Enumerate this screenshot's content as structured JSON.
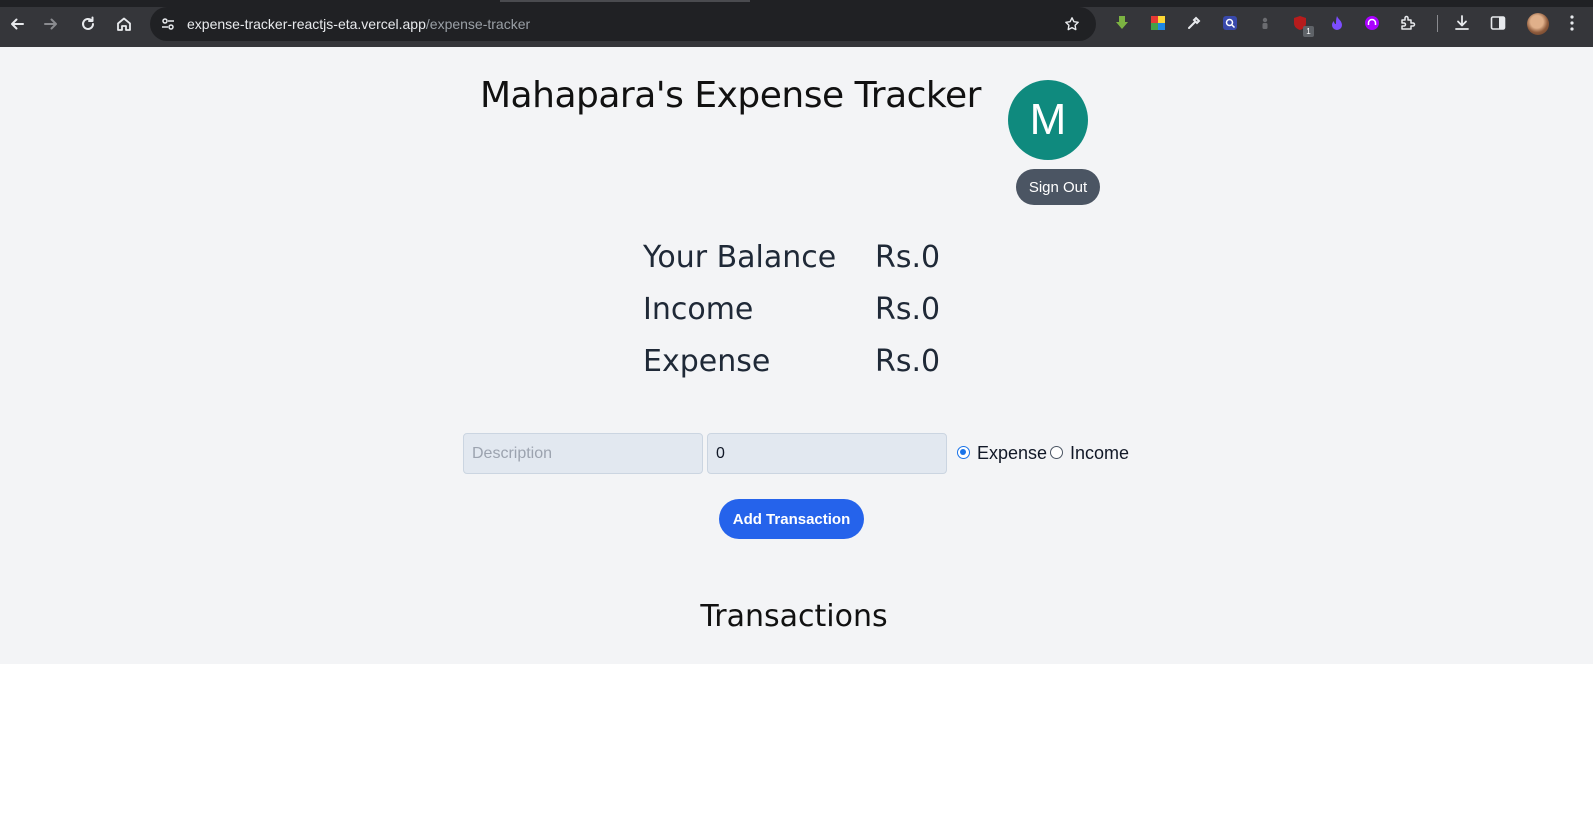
{
  "browser": {
    "url_host": "expense-tracker-reactjs-eta.vercel.app",
    "url_path": "/expense-tracker",
    "extension_badge": "1"
  },
  "header": {
    "title": "Mahapara's Expense Tracker",
    "avatar_initial": "M",
    "avatar_color": "#0f8a7e",
    "sign_out_label": "Sign Out"
  },
  "summary": {
    "rows": [
      {
        "label": "Your Balance",
        "value": "Rs.0"
      },
      {
        "label": "Income",
        "value": "Rs.0"
      },
      {
        "label": "Expense",
        "value": "Rs.0"
      }
    ]
  },
  "form": {
    "description_placeholder": "Description",
    "description_value": "",
    "amount_value": "0",
    "expense_label": "Expense",
    "income_label": "Income",
    "selected_type": "Expense",
    "submit_label": "Add Transaction",
    "submit_color": "#2563eb"
  },
  "transactions": {
    "heading": "Transactions"
  }
}
